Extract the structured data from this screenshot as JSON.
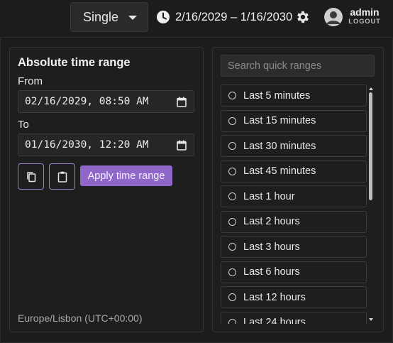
{
  "header": {
    "mode_select": {
      "value": "Single"
    },
    "range_text": "2/16/2029 – 1/16/2030",
    "icons": {
      "clock": "clock-icon",
      "settings": "gear-icon",
      "avatar": "user-avatar-icon"
    },
    "user": {
      "name": "admin",
      "logout_label": "LOGOUT"
    }
  },
  "absolute": {
    "title": "Absolute time range",
    "from_label": "From",
    "from_value": "02/16/2029, 08:50 AM",
    "to_label": "To",
    "to_value": "01/16/2030, 12:20 AM",
    "copy_icon": "copy-icon",
    "paste_icon": "clipboard-icon",
    "apply_label": "Apply time range",
    "timezone": "Europe/Lisbon (UTC+00:00)"
  },
  "quick": {
    "search_placeholder": "Search quick ranges",
    "items": [
      "Last 5 minutes",
      "Last 15 minutes",
      "Last 30 minutes",
      "Last 45 minutes",
      "Last 1 hour",
      "Last 2 hours",
      "Last 3 hours",
      "Last 6 hours",
      "Last 12 hours",
      "Last 24 hours"
    ]
  },
  "colors": {
    "accent": "#8e67c9",
    "accent_border": "#9d7fd0",
    "background": "#1c1c1c",
    "panel_border": "#333333"
  }
}
